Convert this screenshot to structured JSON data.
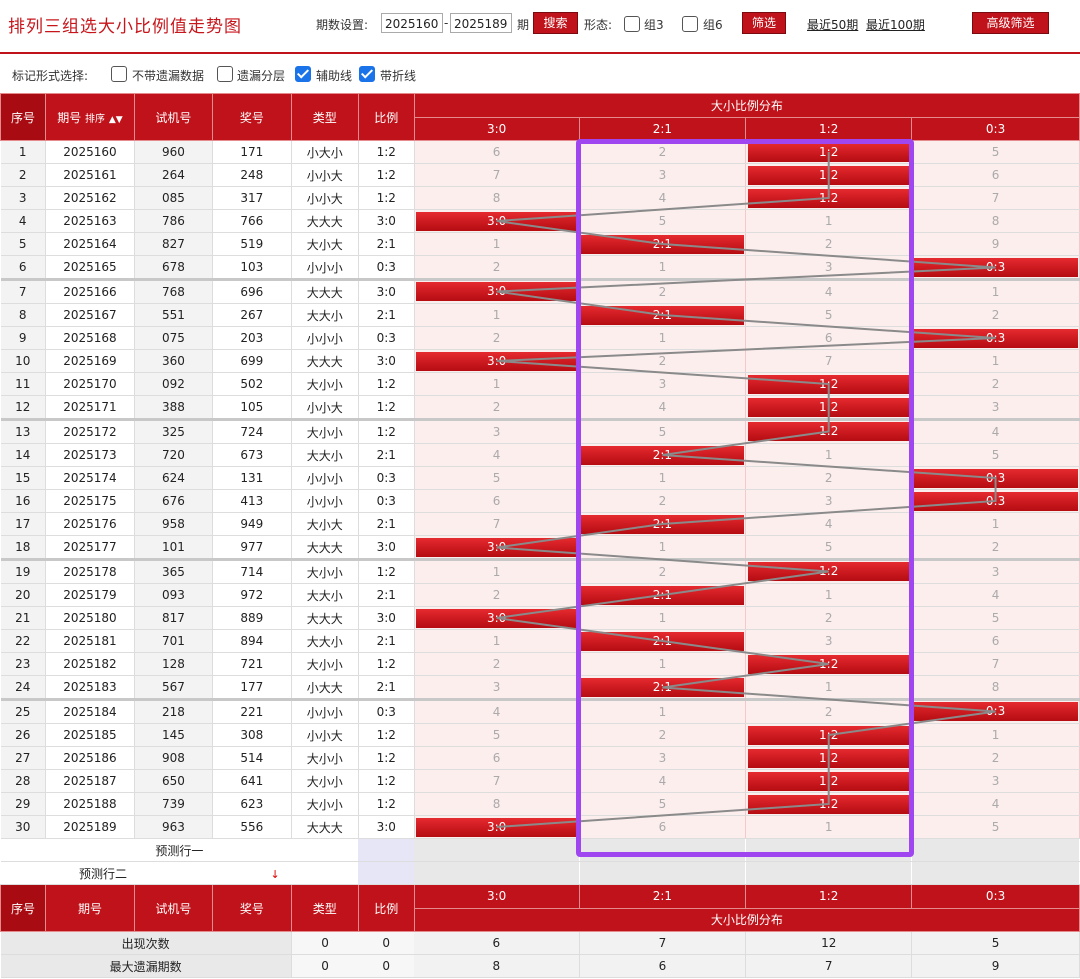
{
  "header": {
    "title": "排列三组选大小比例值走势图",
    "period_label": "期数设置:",
    "period_from": "2025160",
    "period_sep": "-",
    "period_to": "2025189",
    "period_unit": "期",
    "search_btn": "搜索",
    "shape_label": "形态:",
    "group3": "组3",
    "group6": "组6",
    "filter_btn": "筛选",
    "recent50": "最近50期",
    "recent100": "最近100期",
    "adv_btn": "高级筛选"
  },
  "options": {
    "label": "标记形式选择:",
    "items": [
      {
        "label": "不带遗漏数据",
        "checked": false
      },
      {
        "label": "遗漏分层",
        "checked": false
      },
      {
        "label": "辅助线",
        "checked": true
      },
      {
        "label": "带折线",
        "checked": true
      }
    ]
  },
  "table": {
    "headers": {
      "seq": "序号",
      "period": "期号",
      "sort": "排序",
      "trial": "试机号",
      "prize": "奖号",
      "type": "类型",
      "ratio": "比例",
      "dist": "大小比例分布"
    },
    "dist_cols": [
      "3:0",
      "2:1",
      "1:2",
      "0:3"
    ],
    "rows": [
      {
        "seq": "1",
        "period": "2025160",
        "trial": "960",
        "prize": "171",
        "type": "小大小",
        "ratio": "1:2",
        "hit": 2,
        "miss": [
          "6",
          "2",
          "",
          "5"
        ]
      },
      {
        "seq": "2",
        "period": "2025161",
        "trial": "264",
        "prize": "248",
        "type": "小小大",
        "ratio": "1:2",
        "hit": 2,
        "miss": [
          "7",
          "3",
          "",
          "6"
        ]
      },
      {
        "seq": "3",
        "period": "2025162",
        "trial": "085",
        "prize": "317",
        "type": "小小大",
        "ratio": "1:2",
        "hit": 2,
        "miss": [
          "8",
          "4",
          "",
          "7"
        ]
      },
      {
        "seq": "4",
        "period": "2025163",
        "trial": "786",
        "prize": "766",
        "type": "大大大",
        "ratio": "3:0",
        "hit": 0,
        "miss": [
          "",
          "5",
          "1",
          "8"
        ]
      },
      {
        "seq": "5",
        "period": "2025164",
        "trial": "827",
        "prize": "519",
        "type": "大小大",
        "ratio": "2:1",
        "hit": 1,
        "miss": [
          "1",
          "",
          "2",
          "9"
        ]
      },
      {
        "seq": "6",
        "period": "2025165",
        "trial": "678",
        "prize": "103",
        "type": "小小小",
        "ratio": "0:3",
        "hit": 3,
        "miss": [
          "2",
          "1",
          "3",
          ""
        ]
      },
      {
        "seq": "7",
        "period": "2025166",
        "trial": "768",
        "prize": "696",
        "type": "大大大",
        "ratio": "3:0",
        "hit": 0,
        "miss": [
          "",
          "2",
          "4",
          "1"
        ]
      },
      {
        "seq": "8",
        "period": "2025167",
        "trial": "551",
        "prize": "267",
        "type": "大大小",
        "ratio": "2:1",
        "hit": 1,
        "miss": [
          "1",
          "",
          "5",
          "2"
        ]
      },
      {
        "seq": "9",
        "period": "2025168",
        "trial": "075",
        "prize": "203",
        "type": "小小小",
        "ratio": "0:3",
        "hit": 3,
        "miss": [
          "2",
          "1",
          "6",
          ""
        ]
      },
      {
        "seq": "10",
        "period": "2025169",
        "trial": "360",
        "prize": "699",
        "type": "大大大",
        "ratio": "3:0",
        "hit": 0,
        "miss": [
          "",
          "2",
          "7",
          "1"
        ]
      },
      {
        "seq": "11",
        "period": "2025170",
        "trial": "092",
        "prize": "502",
        "type": "大小小",
        "ratio": "1:2",
        "hit": 2,
        "miss": [
          "1",
          "3",
          "",
          "2"
        ]
      },
      {
        "seq": "12",
        "period": "2025171",
        "trial": "388",
        "prize": "105",
        "type": "小小大",
        "ratio": "1:2",
        "hit": 2,
        "miss": [
          "2",
          "4",
          "",
          "3"
        ]
      },
      {
        "seq": "13",
        "period": "2025172",
        "trial": "325",
        "prize": "724",
        "type": "大小小",
        "ratio": "1:2",
        "hit": 2,
        "miss": [
          "3",
          "5",
          "",
          "4"
        ]
      },
      {
        "seq": "14",
        "period": "2025173",
        "trial": "720",
        "prize": "673",
        "type": "大大小",
        "ratio": "2:1",
        "hit": 1,
        "miss": [
          "4",
          "",
          "1",
          "5"
        ]
      },
      {
        "seq": "15",
        "period": "2025174",
        "trial": "624",
        "prize": "131",
        "type": "小小小",
        "ratio": "0:3",
        "hit": 3,
        "miss": [
          "5",
          "1",
          "2",
          ""
        ]
      },
      {
        "seq": "16",
        "period": "2025175",
        "trial": "676",
        "prize": "413",
        "type": "小小小",
        "ratio": "0:3",
        "hit": 3,
        "miss": [
          "6",
          "2",
          "3",
          ""
        ]
      },
      {
        "seq": "17",
        "period": "2025176",
        "trial": "958",
        "prize": "949",
        "type": "大小大",
        "ratio": "2:1",
        "hit": 1,
        "miss": [
          "7",
          "",
          "4",
          "1"
        ]
      },
      {
        "seq": "18",
        "period": "2025177",
        "trial": "101",
        "prize": "977",
        "type": "大大大",
        "ratio": "3:0",
        "hit": 0,
        "miss": [
          "",
          "1",
          "5",
          "2"
        ]
      },
      {
        "seq": "19",
        "period": "2025178",
        "trial": "365",
        "prize": "714",
        "type": "大小小",
        "ratio": "1:2",
        "hit": 2,
        "miss": [
          "1",
          "2",
          "",
          "3"
        ]
      },
      {
        "seq": "20",
        "period": "2025179",
        "trial": "093",
        "prize": "972",
        "type": "大大小",
        "ratio": "2:1",
        "hit": 1,
        "miss": [
          "2",
          "",
          "1",
          "4"
        ]
      },
      {
        "seq": "21",
        "period": "2025180",
        "trial": "817",
        "prize": "889",
        "type": "大大大",
        "ratio": "3:0",
        "hit": 0,
        "miss": [
          "",
          "1",
          "2",
          "5"
        ]
      },
      {
        "seq": "22",
        "period": "2025181",
        "trial": "701",
        "prize": "894",
        "type": "大大小",
        "ratio": "2:1",
        "hit": 1,
        "miss": [
          "1",
          "",
          "3",
          "6"
        ]
      },
      {
        "seq": "23",
        "period": "2025182",
        "trial": "128",
        "prize": "721",
        "type": "大小小",
        "ratio": "1:2",
        "hit": 2,
        "miss": [
          "2",
          "1",
          "",
          "7"
        ]
      },
      {
        "seq": "24",
        "period": "2025183",
        "trial": "567",
        "prize": "177",
        "type": "小大大",
        "ratio": "2:1",
        "hit": 1,
        "miss": [
          "3",
          "",
          "1",
          "8"
        ]
      },
      {
        "seq": "25",
        "period": "2025184",
        "trial": "218",
        "prize": "221",
        "type": "小小小",
        "ratio": "0:3",
        "hit": 3,
        "miss": [
          "4",
          "1",
          "2",
          ""
        ]
      },
      {
        "seq": "26",
        "period": "2025185",
        "trial": "145",
        "prize": "308",
        "type": "小小大",
        "ratio": "1:2",
        "hit": 2,
        "miss": [
          "5",
          "2",
          "",
          "1"
        ]
      },
      {
        "seq": "27",
        "period": "2025186",
        "trial": "908",
        "prize": "514",
        "type": "大小小",
        "ratio": "1:2",
        "hit": 2,
        "miss": [
          "6",
          "3",
          "",
          "2"
        ]
      },
      {
        "seq": "28",
        "period": "2025187",
        "trial": "650",
        "prize": "641",
        "type": "大小小",
        "ratio": "1:2",
        "hit": 2,
        "miss": [
          "7",
          "4",
          "",
          "3"
        ]
      },
      {
        "seq": "29",
        "period": "2025188",
        "trial": "739",
        "prize": "623",
        "type": "大小小",
        "ratio": "1:2",
        "hit": 2,
        "miss": [
          "8",
          "5",
          "",
          "4"
        ]
      },
      {
        "seq": "30",
        "period": "2025189",
        "trial": "963",
        "prize": "556",
        "type": "大大大",
        "ratio": "3:0",
        "hit": 0,
        "miss": [
          "",
          "6",
          "1",
          "5"
        ]
      }
    ],
    "predict1": "预测行一",
    "predict2": "预测行二",
    "stats": [
      {
        "label": "出现次数",
        "type": "0",
        "ratio": "0",
        "vals": [
          "6",
          "7",
          "12",
          "5"
        ]
      },
      {
        "label": "最大遗漏期数",
        "type": "0",
        "ratio": "0",
        "vals": [
          "8",
          "6",
          "7",
          "9"
        ]
      }
    ]
  },
  "colors": {
    "accent": "#c0121a",
    "highlight": "#9f46f0"
  }
}
